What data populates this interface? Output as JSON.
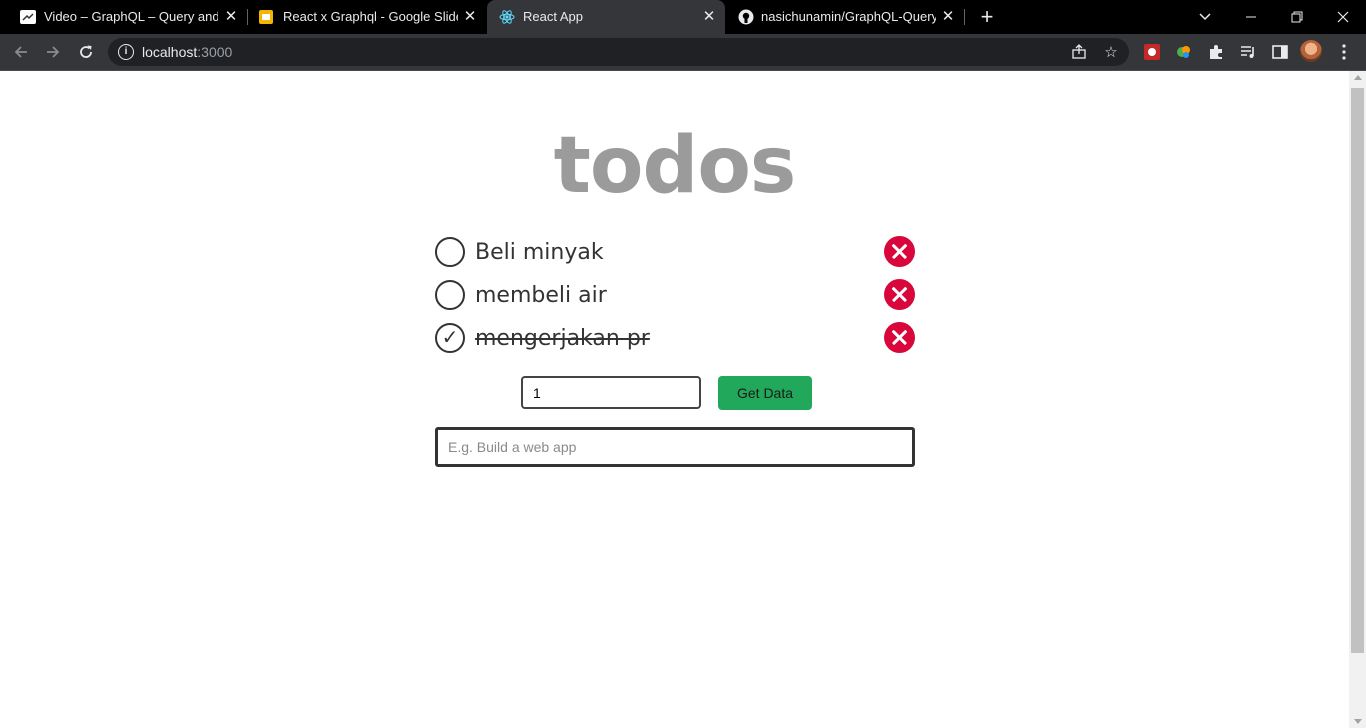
{
  "browser": {
    "tabs": [
      {
        "title": "Video – GraphQL – Query and Ap",
        "icon": "video-favicon"
      },
      {
        "title": "React x Graphql - Google Slides",
        "icon": "google-slides-favicon"
      },
      {
        "title": "React App",
        "icon": "react-favicon"
      },
      {
        "title": "nasichunamin/GraphQL-Query-a",
        "icon": "github-favicon"
      }
    ],
    "url_host": "localhost",
    "url_port": ":3000"
  },
  "app": {
    "title": "todos",
    "todos": [
      {
        "text": "Beli minyak",
        "completed": false
      },
      {
        "text": "membeli air",
        "completed": false
      },
      {
        "text": "mengerjakan pr",
        "completed": true
      }
    ],
    "id_input_value": "1",
    "get_button_label": "Get Data",
    "new_todo_placeholder": "E.g. Build a web app",
    "checkmark": "✓"
  },
  "colors": {
    "delete": "#d9063c",
    "get_button": "#22a85a",
    "title": "#9b9b9b"
  }
}
